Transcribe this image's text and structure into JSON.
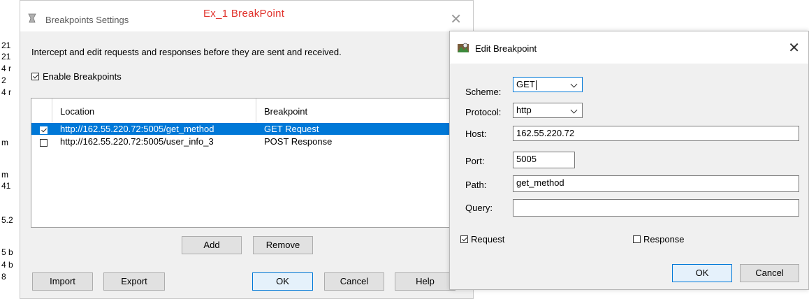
{
  "background": {
    "edge_fragments": [
      "21",
      "21",
      "4 r",
      "2",
      "4 r",
      "m",
      "m",
      "41",
      "5.2",
      "5 b",
      "4 b",
      "8"
    ]
  },
  "settings_dialog": {
    "title": "Breakpoints Settings",
    "annotation": "Ex_1 BreakPoint",
    "annotation_color": "#e0302a",
    "close_glyph": "✕",
    "description": "Intercept and edit requests and responses before they are sent and received.",
    "enable_label": "Enable Breakpoints",
    "enable_checked": true,
    "columns": [
      "Location",
      "Breakpoint"
    ],
    "rows": [
      {
        "checked": true,
        "location": "http://162.55.220.72:5005/get_method",
        "breakpoint": "GET Request",
        "selected": true
      },
      {
        "checked": false,
        "location": "http://162.55.220.72:5005/user_info_3",
        "breakpoint": "POST Response",
        "selected": false
      }
    ],
    "add_label": "Add",
    "remove_label": "Remove",
    "import_label": "Import",
    "export_label": "Export",
    "ok_label": "OK",
    "cancel_label": "Cancel",
    "help_label": "Help",
    "selection_color": "#0078d7"
  },
  "edit_dialog": {
    "title": "Edit Breakpoint",
    "close_glyph": "✕",
    "scheme_label": "Scheme:",
    "scheme_value": "GET",
    "protocol_label": "Protocol:",
    "protocol_value": "http",
    "host_label": "Host:",
    "host_value": "162.55.220.72",
    "port_label": "Port:",
    "port_value": "5005",
    "path_label": "Path:",
    "path_value": "get_method",
    "query_label": "Query:",
    "query_value": "",
    "request_label": "Request",
    "request_checked": true,
    "response_label": "Response",
    "response_checked": false,
    "ok_label": "OK",
    "cancel_label": "Cancel"
  }
}
